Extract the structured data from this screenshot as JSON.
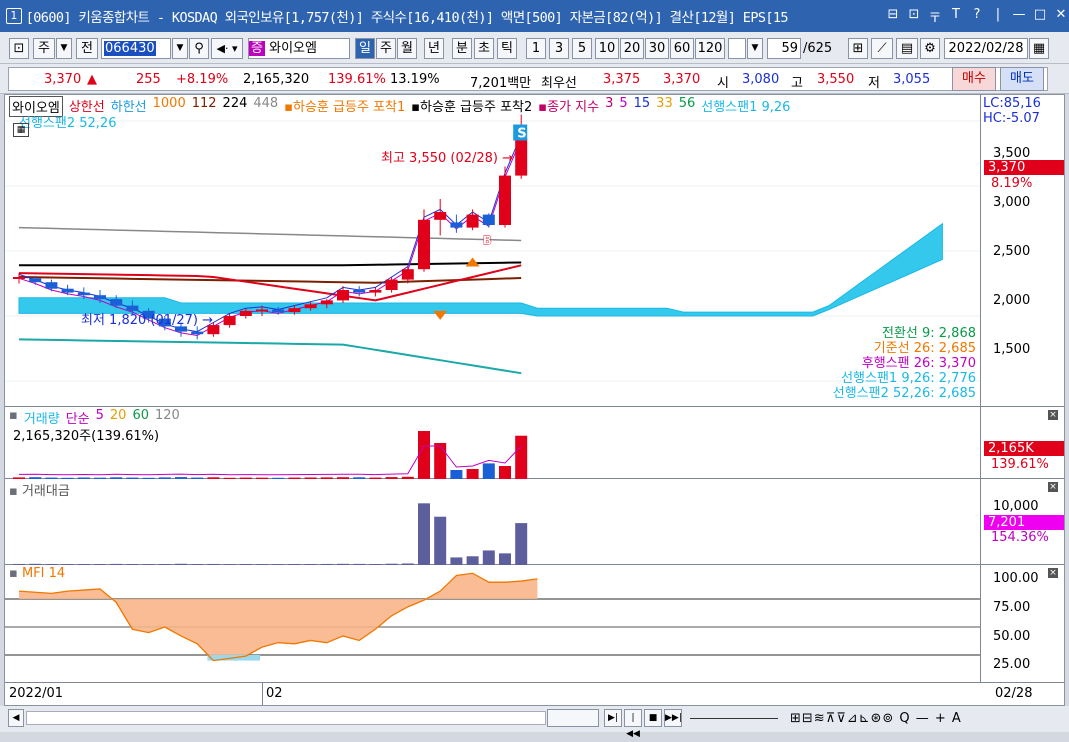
{
  "window": {
    "num": "1",
    "title": "[0600] 키움종합차트 - KOSDAQ 외국인보유[1,757(천)] 주식수[16,410(천)] 액면[500] 자본금[82(억)] 결산[12월] EPS[15",
    "controls": [
      "⊟",
      "⊡",
      "〒",
      "T",
      "?",
      "|",
      "—",
      "□",
      "✕"
    ]
  },
  "toolbar": {
    "mkt": "주",
    "jeon": "전",
    "code": "066430",
    "badge": "증",
    "name": "와이오엠",
    "periods": [
      "일",
      "주",
      "월",
      "년",
      "분",
      "초",
      "틱"
    ],
    "active_period": "일",
    "nums": [
      "1",
      "3",
      "5",
      "10",
      "20",
      "30",
      "60",
      "120"
    ],
    "count": "59",
    "total": "/625",
    "date": "2022/02/28"
  },
  "info": {
    "price": "3,370",
    "arrow": "▲",
    "change": "255",
    "pct": "+8.19%",
    "volume": "2,165,320",
    "vol_ratio": "139.61%",
    "turnover": "13.19%",
    "amount": "7,201백만",
    "priority": "최우선",
    "ask": "3,375",
    "bid": "3,370",
    "open_lbl": "시",
    "open": "3,080",
    "high_lbl": "고",
    "high": "3,550",
    "low_lbl": "저",
    "low": "3,055",
    "buy": "매수",
    "sell": "매도"
  },
  "price_pane": {
    "legend": [
      {
        "t": "와이오엠",
        "c": "#000"
      },
      {
        "t": "상한선",
        "c": "#e0001a"
      },
      {
        "t": "하한선",
        "c": "#1a9adf"
      },
      {
        "t": "1000",
        "c": "#f07800"
      },
      {
        "t": "112",
        "c": "#7a2000"
      },
      {
        "t": "224",
        "c": "#000"
      },
      {
        "t": "448",
        "c": "#888"
      },
      {
        "t": "▪하승훈 급등주 포착1",
        "c": "#f07800"
      },
      {
        "t": "▪하승훈 급등주 포착2",
        "c": "#000"
      },
      {
        "t": "▪종가 지수",
        "c": "#c0006a"
      },
      {
        "t": "3",
        "c": "#c0006a"
      },
      {
        "t": "5",
        "c": "#c000c0"
      },
      {
        "t": "15",
        "c": "#1a2fd6"
      },
      {
        "t": "33",
        "c": "#e0a000"
      },
      {
        "t": "56",
        "c": "#0a9a4a"
      },
      {
        "t": "선행스팬1 9,26",
        "c": "#1ab8e6"
      }
    ],
    "legend2": "선행스팬2 52,26",
    "lc": "LC:85,16",
    "hc": "HC:-5.07",
    "high_note": "최고 3,550 (02/28) →",
    "low_note": "최저 1,820 (01/27) →",
    "yticks": [
      "3,500",
      "3,000",
      "2,500",
      "2,000",
      "1,500"
    ],
    "cur_tag": "3,370",
    "cur_pct": "8.19%",
    "ichi": [
      {
        "t": "전환선 9: 2,868",
        "c": "#0a9a4a"
      },
      {
        "t": "기준선 26: 2,685",
        "c": "#f07800"
      },
      {
        "t": "후행스팬 26: 3,370",
        "c": "#c000c0"
      },
      {
        "t": "선행스팬1 9,26: 2,776",
        "c": "#1ab8e6"
      },
      {
        "t": "선행스팬2 52,26: 2,685",
        "c": "#1ab8e6"
      }
    ],
    "signals": [
      "S",
      "B"
    ]
  },
  "vol_pane": {
    "title": "거래량",
    "ma_lbl": "단순",
    "ma": [
      {
        "t": "5",
        "c": "#c000c0"
      },
      {
        "t": "20",
        "c": "#e0a000"
      },
      {
        "t": "60",
        "c": "#0a9a4a"
      },
      {
        "t": "120",
        "c": "#888"
      }
    ],
    "value": "2,165,320주(139.61%)",
    "tag": "2,165K",
    "tag_pct": "139.61%"
  },
  "amt_pane": {
    "title": "거래대금",
    "ytick": "10,000",
    "tag": "7,201",
    "tag_pct": "154.36%"
  },
  "mfi_pane": {
    "title": "MFI 14",
    "yticks": [
      "100.00",
      "75.00",
      "50.00",
      "25.00"
    ]
  },
  "xaxis": {
    "labels": [
      "2022/01",
      "02"
    ],
    "right": "02/28"
  },
  "chart_data": [
    {
      "type": "candlestick",
      "title": "와이오엠",
      "ylim": [
        1300,
        3700
      ],
      "ohlc": [
        [
          2290,
          2330,
          2250,
          2300
        ],
        [
          2290,
          2310,
          2240,
          2260
        ],
        [
          2260,
          2280,
          2190,
          2210
        ],
        [
          2210,
          2240,
          2160,
          2180
        ],
        [
          2180,
          2220,
          2130,
          2160
        ],
        [
          2160,
          2200,
          2100,
          2130
        ],
        [
          2130,
          2160,
          2060,
          2080
        ],
        [
          2080,
          2120,
          2010,
          2040
        ],
        [
          2040,
          2060,
          1950,
          1980
        ],
        [
          1980,
          2000,
          1890,
          1920
        ],
        [
          1920,
          1950,
          1840,
          1880
        ],
        [
          1880,
          1920,
          1820,
          1860
        ],
        [
          1860,
          1950,
          1840,
          1930
        ],
        [
          1930,
          2020,
          1910,
          2000
        ],
        [
          2000,
          2060,
          1980,
          2040
        ],
        [
          2040,
          2080,
          2000,
          2050
        ],
        [
          2050,
          2070,
          2010,
          2030
        ],
        [
          2030,
          2080,
          2010,
          2060
        ],
        [
          2060,
          2110,
          2040,
          2090
        ],
        [
          2090,
          2130,
          2060,
          2120
        ],
        [
          2120,
          2230,
          2100,
          2200
        ],
        [
          2200,
          2230,
          2150,
          2180
        ],
        [
          2180,
          2220,
          2150,
          2200
        ],
        [
          2200,
          2300,
          2180,
          2280
        ],
        [
          2280,
          2380,
          2250,
          2360
        ],
        [
          2360,
          2820,
          2340,
          2740
        ],
        [
          2740,
          2900,
          2620,
          2800
        ],
        [
          2720,
          2780,
          2640,
          2680
        ],
        [
          2680,
          2820,
          2660,
          2780
        ],
        [
          2780,
          2790,
          2680,
          2700
        ],
        [
          2700,
          3150,
          2680,
          3080
        ],
        [
          3080,
          3550,
          3055,
          3370
        ]
      ]
    },
    {
      "type": "bar",
      "title": "거래량",
      "values": [
        80,
        90,
        70,
        60,
        75,
        65,
        85,
        70,
        60,
        80,
        95,
        70,
        85,
        60,
        70,
        65,
        60,
        70,
        75,
        80,
        90,
        85,
        70,
        95,
        110,
        2400,
        1800,
        450,
        500,
        780,
        650,
        2165
      ],
      "unit": "천주"
    },
    {
      "type": "bar",
      "title": "거래대금",
      "values": [
        180,
        200,
        160,
        140,
        170,
        150,
        190,
        160,
        130,
        170,
        210,
        150,
        180,
        130,
        160,
        140,
        130,
        160,
        170,
        180,
        200,
        190,
        160,
        220,
        260,
        10600,
        8300,
        1300,
        1500,
        2500,
        2000,
        7201
      ],
      "unit": "백만"
    },
    {
      "type": "area",
      "title": "MFI 14",
      "ylim": [
        0,
        100
      ],
      "values": [
        82,
        81,
        80,
        82,
        83,
        84,
        72,
        48,
        45,
        50,
        42,
        35,
        20,
        22,
        24,
        32,
        36,
        35,
        38,
        36,
        42,
        38,
        48,
        60,
        68,
        74,
        82,
        96,
        98,
        90,
        90,
        91,
        93
      ]
    }
  ],
  "statusbar": {
    "nav": [
      "▶|",
      "|◀◀",
      "■",
      "▶▶|"
    ],
    "tools": "⊞⊟≋⊼⊽⊿⊾⊛⊚ Q — + A"
  }
}
